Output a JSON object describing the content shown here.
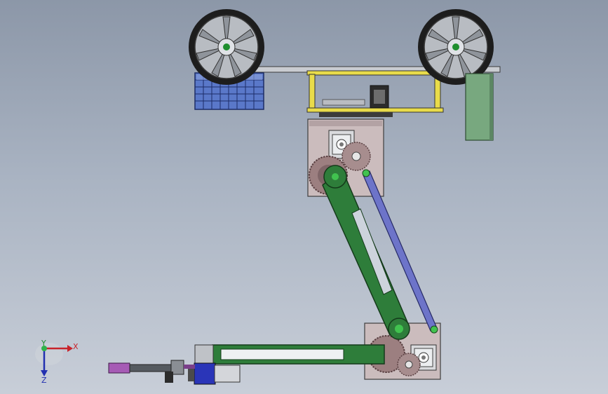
{
  "triad": {
    "x_label": "X",
    "y_label": "Y",
    "z_label": "Z"
  }
}
